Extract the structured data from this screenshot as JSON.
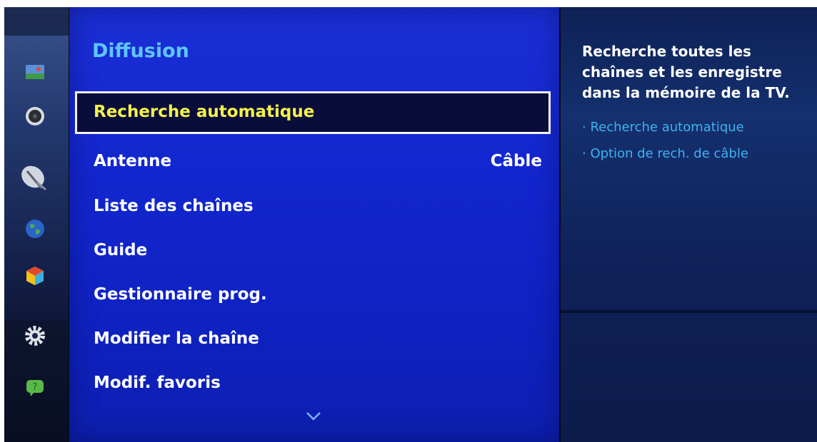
{
  "sidebar": {
    "icons": [
      "picture-icon",
      "sound-icon",
      "broadcast-satellite-icon",
      "network-globe-icon",
      "smart-hub-cube-icon",
      "settings-gear-icon",
      "support-chat-icon"
    ]
  },
  "menu": {
    "title": "Diffusion",
    "items": [
      {
        "label": "Recherche automatique",
        "value": ""
      },
      {
        "label": "Antenne",
        "value": "Câble"
      },
      {
        "label": "Liste des chaînes",
        "value": ""
      },
      {
        "label": "Guide",
        "value": ""
      },
      {
        "label": "Gestionnaire prog.",
        "value": ""
      },
      {
        "label": "Modifier la chaîne",
        "value": ""
      },
      {
        "label": "Modif. favoris",
        "value": ""
      }
    ],
    "scroll_icon": "chevron-down-icon"
  },
  "help": {
    "description": "Recherche toutes les chaînes et les enregistre dans la mémoire de la TV.",
    "links": [
      "· Recherche automatique",
      "· Option de rech. de câble"
    ]
  },
  "colors": {
    "menu_bg": "#1226cf",
    "title": "#5fc6ff",
    "selected_text": "#f4f24a",
    "link": "#3fb2f0"
  }
}
